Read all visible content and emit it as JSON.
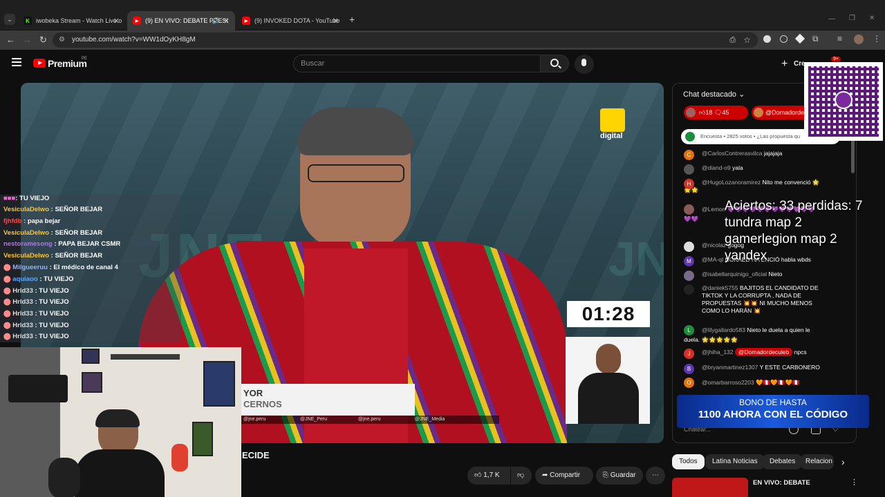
{
  "tabs": [
    {
      "title": "iwobeka Stream - Watch Live o",
      "icon_color": "#53fc18",
      "icon": "K"
    },
    {
      "title": "(9) EN VIVO: DEBATE PRESI",
      "icon_color": "#ff0000",
      "icon": "▶"
    },
    {
      "title": "(9) INVOKED DOTA - YouTube",
      "icon_color": "#ff0000",
      "icon": "▶"
    }
  ],
  "url": "youtube.com/watch?v=WW1dOyKH8gM",
  "header": {
    "logo": "Premium",
    "logo_region": "PE",
    "search_placeholder": "Buscar",
    "create_label": "Cre",
    "notif_count": "9+"
  },
  "video": {
    "timer": "01:28",
    "channel_logo": "digital",
    "bg_text": "JNE",
    "lower_third_1": "YOR",
    "lower_third_2": "CERNOS",
    "socials": [
      "@jne.peru",
      "@JNE_Peru",
      "@jne.peru",
      "@JNE_Media"
    ]
  },
  "overlay_chat": [
    {
      "user": "",
      "text": ": TU VIEJO",
      "color": "#ff5ad0"
    },
    {
      "user": "VesiculaDelwo",
      "text": ": SEÑOR BEJAR",
      "color": "#f5c542"
    },
    {
      "user": "fjhfdb",
      "text": ": papa bejar",
      "color": "#ff4a4a"
    },
    {
      "user": "VesiculaDelwo",
      "text": ": SEÑOR BEJAR",
      "color": "#f5c542"
    },
    {
      "user": "nestoramesong",
      "text": ": PAPA BEJAR CSMR",
      "color": "#b66bff"
    },
    {
      "user": "VesiculaDelwo",
      "text": ": SEÑOR BEJAR",
      "color": "#f5c542"
    },
    {
      "user": "Milgueeruu",
      "text": ": El médico de canal 4",
      "color": "#8fb4ff"
    },
    {
      "user": "aquiaoo",
      "text": ": TU VIEJO",
      "color": "#5fa8ff"
    },
    {
      "user": "Hrld33",
      "text": ": TU VIEJO",
      "color": "#dddddd"
    },
    {
      "user": "Hrld33",
      "text": ": TU VIEJO",
      "color": "#dddddd"
    },
    {
      "user": "Hrld33",
      "text": ": TU VIEJO",
      "color": "#dddddd"
    },
    {
      "user": "Hrld33",
      "text": ": TU VIEJO",
      "color": "#dddddd"
    },
    {
      "user": "Hrld33",
      "text": ": TU VIEJO",
      "color": "#dddddd"
    }
  ],
  "stats_overlay": [
    "Aciertos: 33 perdidas: 7",
    "tundra map 2",
    "gamerlegion map 2",
    "yandex"
  ],
  "video_title": "ECIDE",
  "actions": {
    "likes": "1,7 K",
    "share": "Compartir",
    "save": "Guardar"
  },
  "chat": {
    "header": "Chat destacado",
    "pinned_stats": {
      "likes": "18",
      "comments": "45"
    },
    "pinned_user": "@Domadorde",
    "poll": "Encuesta • 2825 votos • ¿Las propuesta qu",
    "messages": [
      {
        "initial": "C",
        "color": "#e8710a",
        "user": "@CarlosContrerasvilca",
        "text": "jajajaja"
      },
      {
        "initial": "",
        "color": "#555555",
        "user": "@diand-o9",
        "text": "yala"
      },
      {
        "initial": "H",
        "color": "#d93025",
        "user": "@HugoLozanoramirez",
        "text": "Nito me convenció 🌟🌟🌟"
      },
      {
        "initial": "",
        "color": "#8a5a5a",
        "user": "@Lemon",
        "text": "💜💜💜💜💜💜💜💜💜💜💜💜💜💜"
      },
      {
        "initial": "",
        "color": "#dddddd",
        "user": "@nicolaz",
        "text": "gogog"
      },
      {
        "initial": "M",
        "color": "#5e35b1",
        "user": "@MA-qI",
        "text": "NOKAED HA ENCIÓ habla wbds"
      },
      {
        "initial": "",
        "color": "#7a6a8a",
        "user": "@isabellarquinigo_oficial",
        "text": "Nieto"
      },
      {
        "initial": "",
        "color": "#222222",
        "user": "@daniek5755",
        "text": "BAJITOS EL CANDIDATO DE TIKTOK Y LA CORRUPTA , NADA DE PROPUESTAS 💥💥 NI MUCHO MENOS COMO LO HARÁN 💥"
      },
      {
        "initial": "L",
        "color": "#1e8e3e",
        "user": "@lilygallardo583",
        "text": "Nieto le duela a quien le duela. 🌟🌟🌟🌟🌟"
      },
      {
        "initial": "J",
        "color": "#d93025",
        "user": "@jhiha_132",
        "text": "npcs",
        "mention": "@Domadordeculeb"
      },
      {
        "initial": "B",
        "color": "#5e35b1",
        "user": "@bryanmartinez1307",
        "text": "Y ESTE CARBONERO"
      },
      {
        "initial": "O",
        "color": "#e8710a",
        "user": "@omarbarroso2203",
        "text": "🧡🇵🇪🧡🇵🇪🧡🇵🇪"
      }
    ],
    "input_placeholder": "Chatear...",
    "banner_1": "BONO DE HASTA",
    "banner_2": "1100 AHORA CON EL CÓDIGO"
  },
  "filters": [
    "Todos",
    "Latina Noticias",
    "Debates",
    "Relacion"
  ],
  "rec_title": "EN VIVO: DEBATE"
}
